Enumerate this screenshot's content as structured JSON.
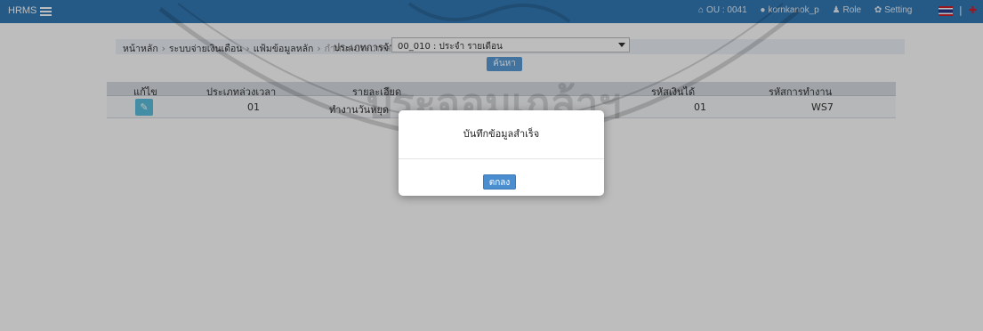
{
  "navbar": {
    "brand": "HRMS",
    "ou": "OU : 0041",
    "username": "kornkanok_p",
    "role": "Role",
    "setting": "Setting",
    "separator": "|"
  },
  "breadcrumb": {
    "items": [
      "หน้าหลัก",
      "ระบบจ่ายเงินเดือน",
      "แฟ้มข้อมูลหลัก"
    ],
    "current": "กำหนดประเภทล่วงเวลา",
    "separator": "›"
  },
  "form": {
    "employment_type_label": "ประเภทการจ้าง",
    "employment_type_value": "00_010 : ประจำ รายเดือน",
    "search_label": "ค้นหา"
  },
  "grid": {
    "headers": [
      "แก้ไข",
      "ประเภทล่วงเวลา",
      "รายละเอียด",
      "รหัสเงินได้",
      "รหัสการทำงาน"
    ],
    "rows": [
      {
        "ot_type": "01",
        "description": "ทำงานวันหยุด",
        "income_code": "01",
        "work_code": "WS7"
      }
    ]
  },
  "modal": {
    "message": "บันทึกข้อมูลสำเร็จ",
    "ok_label": "ตกลง"
  },
  "watermark": {
    "text": "ประจอมเกล้าฯ"
  },
  "colors": {
    "navbar": "#337ab7",
    "accent": "#4a8ed0",
    "edit_button": "#5bc0de"
  },
  "icons": {
    "home": "home-icon",
    "user": "user-icon",
    "role": "users-icon",
    "setting": "gear-icon",
    "edit": "pencil-icon",
    "menu": "hamburger-icon"
  }
}
